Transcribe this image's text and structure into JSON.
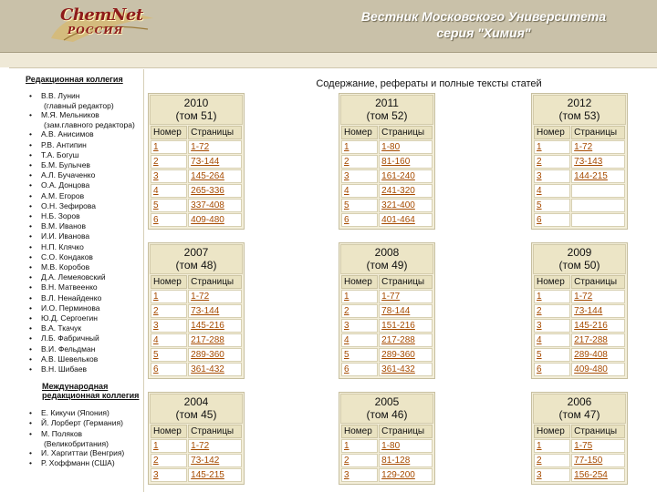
{
  "header": {
    "logo_text": "ChemNet",
    "logo_sub": "РОССИЯ",
    "title_line1": "Вестник Московского Университета",
    "title_line2": "серия \"Химия\""
  },
  "content_title": "Содержание, рефераты и полные тексты статей",
  "sidebar": {
    "board_heading": "Редакционная коллегия",
    "board": [
      {
        "text": "В.В. Лунин"
      },
      {
        "text": "(главный редактор)",
        "sub": true
      },
      {
        "text": "М.Я. Мельников"
      },
      {
        "text": "(зам.главного редактора)",
        "sub": true
      },
      {
        "text": "А.В. Анисимов"
      },
      {
        "text": "Р.В. Антипин"
      },
      {
        "text": "Т.А. Богуш"
      },
      {
        "text": "Б.М. Булычев"
      },
      {
        "text": "А.Л. Бучаченко"
      },
      {
        "text": "О.А. Донцова"
      },
      {
        "text": "А.М. Егоров"
      },
      {
        "text": "О.Н. Зефирова"
      },
      {
        "text": "Н.Б. Зоров"
      },
      {
        "text": "В.М. Иванов"
      },
      {
        "text": "И.И. Иванова"
      },
      {
        "text": "Н.П. Клячко"
      },
      {
        "text": "С.О. Кондаков"
      },
      {
        "text": "М.В. Коробов"
      },
      {
        "text": "Д.А. Лемеяовский"
      },
      {
        "text": "В.Н. Матвеенко"
      },
      {
        "text": "В.Л. Ненайденко"
      },
      {
        "text": "И.О. Перминова"
      },
      {
        "text": "Ю.Д. Сергоегин"
      },
      {
        "text": "В.А. Ткачук"
      },
      {
        "text": "Л.Б. Фабричный"
      },
      {
        "text": "В.И. Фельдман"
      },
      {
        "text": "А.В. Шевельков"
      },
      {
        "text": "В.Н. Шибаев"
      }
    ],
    "intl_heading_line1": "Международная",
    "intl_heading_line2": "редакционная коллегия",
    "intl": [
      {
        "text": "Е. Кикучи (Япония)"
      },
      {
        "text": "Й. Лорберт (Германия)"
      },
      {
        "text": "М. Поляков"
      },
      {
        "text": "(Великобритания)",
        "sub": true
      },
      {
        "text": "И. Харгиттаи (Венгрия)"
      },
      {
        "text": "Р. Хоффманн (США)"
      }
    ]
  },
  "table_headers": {
    "number": "Номер",
    "pages": "Страницы"
  },
  "years": [
    {
      "year": "2010",
      "vol": "(том 51)",
      "rows": [
        [
          "1",
          "1-72"
        ],
        [
          "2",
          "73-144"
        ],
        [
          "3",
          "145-264"
        ],
        [
          "4",
          "265-336"
        ],
        [
          "5",
          "337-408"
        ],
        [
          "6",
          "409-480"
        ]
      ]
    },
    {
      "year": "2011",
      "vol": "(том 52)",
      "rows": [
        [
          "1",
          "1-80"
        ],
        [
          "2",
          "81-160"
        ],
        [
          "3",
          "161-240"
        ],
        [
          "4",
          "241-320"
        ],
        [
          "5",
          "321-400"
        ],
        [
          "6",
          "401-464"
        ]
      ]
    },
    {
      "year": "2012",
      "vol": "(том 53)",
      "rows": [
        [
          "1",
          "1-72"
        ],
        [
          "2",
          "73-143"
        ],
        [
          "3",
          "144-215"
        ],
        [
          "4",
          ""
        ],
        [
          "5",
          ""
        ],
        [
          "6",
          ""
        ]
      ]
    },
    {
      "year": "2007",
      "vol": "(том 48)",
      "rows": [
        [
          "1",
          "1-72"
        ],
        [
          "2",
          "73-144"
        ],
        [
          "3",
          "145-216"
        ],
        [
          "4",
          "217-288"
        ],
        [
          "5",
          "289-360"
        ],
        [
          "6",
          "361-432"
        ]
      ]
    },
    {
      "year": "2008",
      "vol": "(том 49)",
      "rows": [
        [
          "1",
          "1-77"
        ],
        [
          "2",
          "78-144"
        ],
        [
          "3",
          "151-216"
        ],
        [
          "4",
          "217-288"
        ],
        [
          "5",
          "289-360"
        ],
        [
          "6",
          "361-432"
        ]
      ]
    },
    {
      "year": "2009",
      "vol": "(том 50)",
      "rows": [
        [
          "1",
          "1-72"
        ],
        [
          "2",
          "73-144"
        ],
        [
          "3",
          "145-216"
        ],
        [
          "4",
          "217-288"
        ],
        [
          "5",
          "289-408"
        ],
        [
          "6",
          "409-480"
        ]
      ]
    },
    {
      "year": "2004",
      "vol": "(том 45)",
      "rows": [
        [
          "1",
          "1-72"
        ],
        [
          "2",
          "73-142"
        ],
        [
          "3",
          "145-215"
        ]
      ]
    },
    {
      "year": "2005",
      "vol": "(том 46)",
      "rows": [
        [
          "1",
          "1-80"
        ],
        [
          "2",
          "81-128"
        ],
        [
          "3",
          "129-200"
        ]
      ]
    },
    {
      "year": "2006",
      "vol": "(том 47)",
      "rows": [
        [
          "1",
          "1-75"
        ],
        [
          "2",
          "77-150"
        ],
        [
          "3",
          "156-254"
        ]
      ]
    }
  ]
}
